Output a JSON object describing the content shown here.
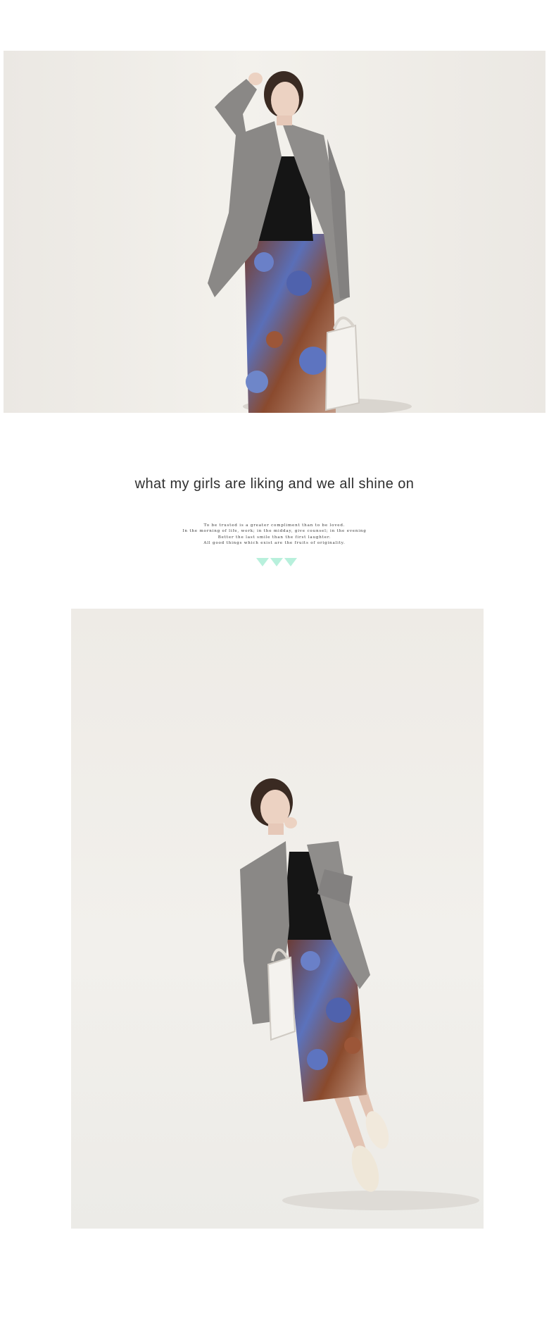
{
  "headline": "what my girls are liking and we all shine on",
  "quote": {
    "lines": [
      "To be trusted is a greater compliment than to be loved.",
      "In the morning of life, work; in the midday, give counsel; in the evening",
      "Better the last smile than the first laughter.",
      "All good things which exist are the fruits of originality."
    ]
  },
  "decoration": {
    "triangle_color": "#b8f0dc",
    "triangle_count": 3
  },
  "colors": {
    "background": "#ffffff",
    "photo_backdrop": "#efece7",
    "text": "#2f2f2f"
  }
}
